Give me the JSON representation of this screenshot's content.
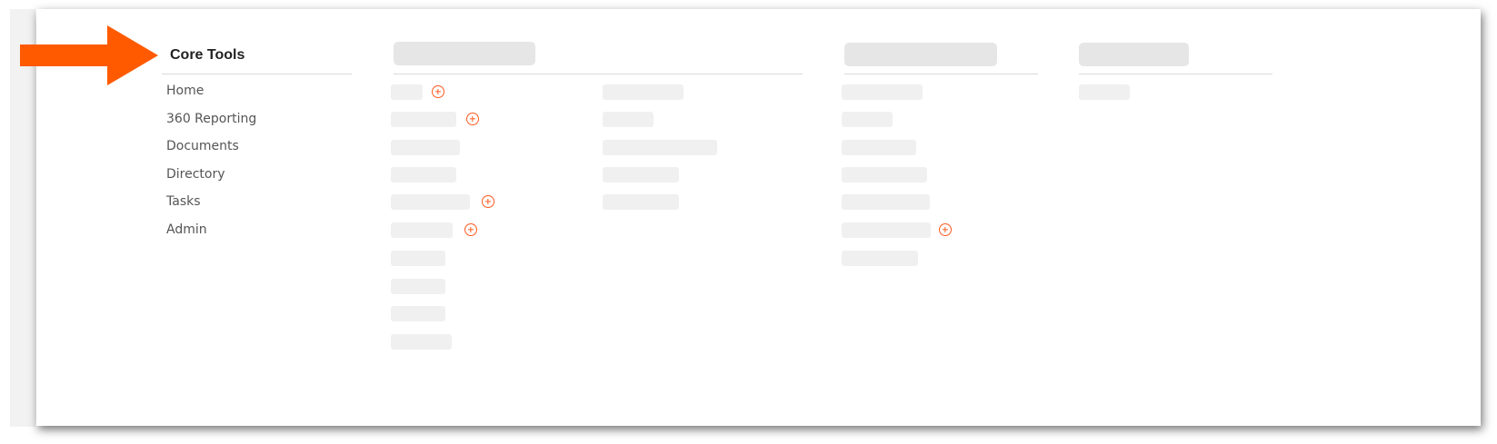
{
  "core_tools": {
    "title": "Core Tools",
    "items": [
      {
        "label": "Home"
      },
      {
        "label": "360 Reporting"
      },
      {
        "label": "Documents"
      },
      {
        "label": "Directory"
      },
      {
        "label": "Tasks"
      },
      {
        "label": "Admin"
      }
    ]
  },
  "annotation": {
    "arrow_color": "#ff5a00"
  },
  "colors": {
    "accent": "#ff5a1f",
    "placeholder": "#f0f0f0",
    "placeholder_heading": "#e6e6e6"
  }
}
